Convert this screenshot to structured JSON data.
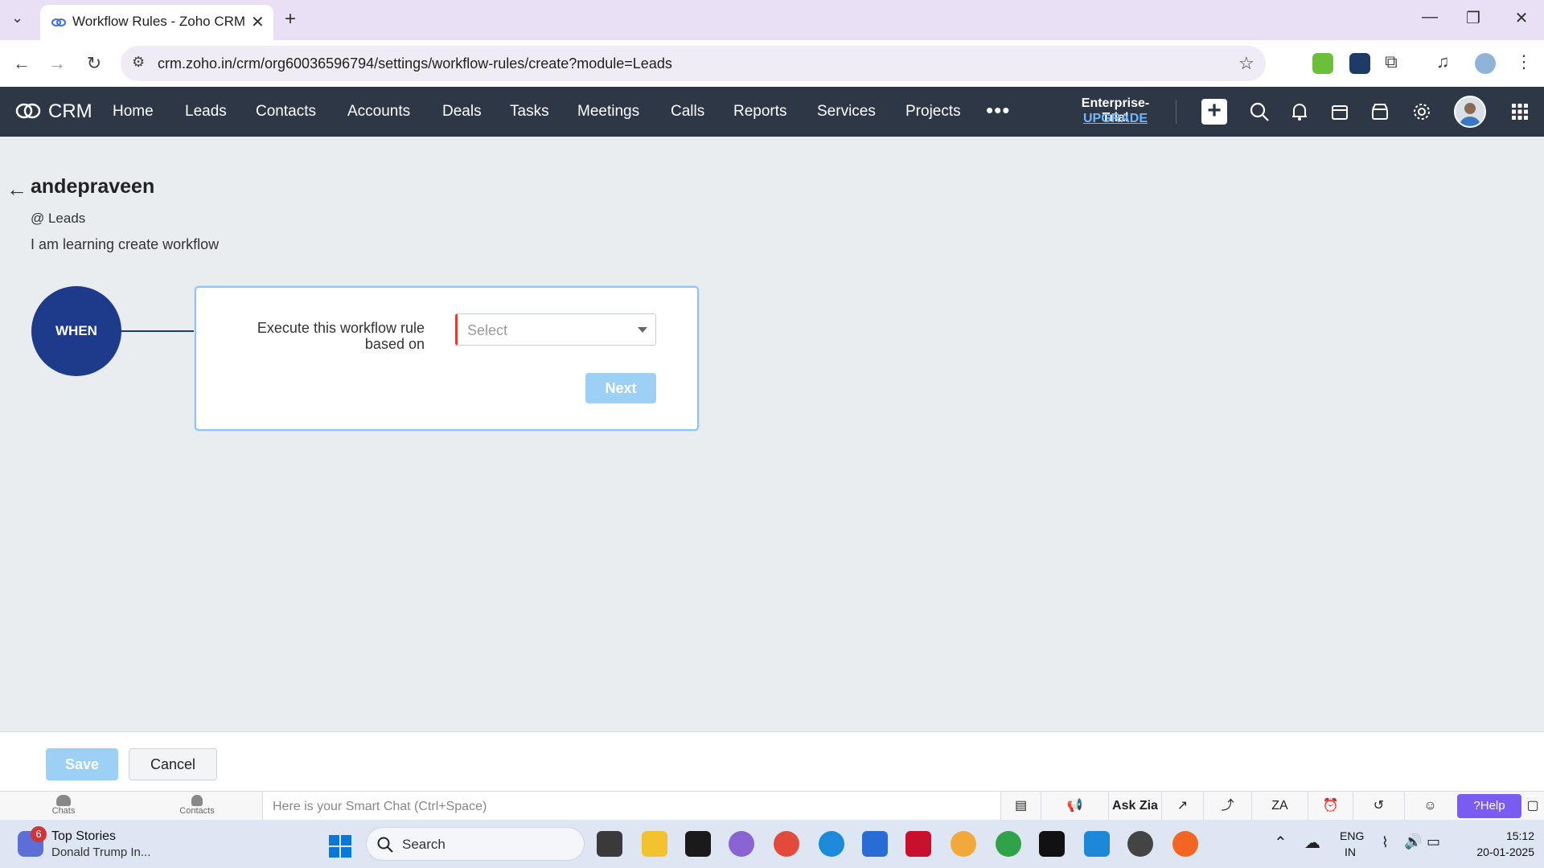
{
  "browser": {
    "tab_title": "Workflow Rules - Zoho CRM",
    "url": "crm.zoho.in/crm/org60036596794/settings/workflow-rules/create?module=Leads"
  },
  "crm_nav": {
    "logo_text": "CRM",
    "items": [
      "Home",
      "Leads",
      "Contacts",
      "Accounts",
      "Deals",
      "Tasks",
      "Meetings",
      "Calls",
      "Reports",
      "Services",
      "Projects"
    ],
    "more": "•••",
    "plan": "Enterprise-Trial",
    "upgrade": "UPGRADE"
  },
  "rule": {
    "name": "andepraveen",
    "module": "@ Leads",
    "description": "I am learning create workflow"
  },
  "when_block": {
    "circle_label": "WHEN",
    "trigger_label": "Execute this workflow rule based on",
    "select_placeholder": "Select",
    "next_label": "Next"
  },
  "footer": {
    "save_label": "Save",
    "cancel_label": "Cancel"
  },
  "chat_bar": {
    "chats_label": "Chats",
    "contacts_label": "Contacts",
    "smartchat_placeholder": "Here is your Smart Chat (Ctrl+Space)",
    "ask_zia": "Ask Zia",
    "help": "?Help"
  },
  "taskbar": {
    "news_badge": "6",
    "news_title": "Top Stories",
    "news_subtitle": "Donald Trump In...",
    "search_placeholder": "Search",
    "lang_line1": "ENG",
    "lang_line2": "IN",
    "time": "15:12",
    "date": "20-01-2025"
  },
  "colors": {
    "crm_bar": "#2d3746",
    "when_circle": "#1e3a8a",
    "disabled_button": "#9cd0f5",
    "required_marker": "#e53935",
    "help_button": "#7b5cf0"
  }
}
